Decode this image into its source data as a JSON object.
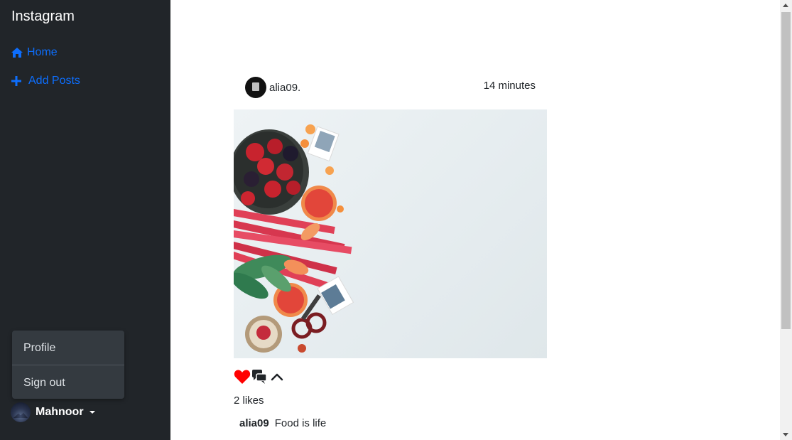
{
  "sidebar": {
    "brand": "Instagram",
    "items": [
      {
        "label": "Home",
        "icon": "home-icon"
      },
      {
        "label": "Add Posts",
        "icon": "plus-icon"
      }
    ],
    "dropdown": {
      "items": [
        {
          "label": "Profile"
        },
        {
          "label": "Sign out"
        }
      ]
    },
    "user": {
      "name": "Mahnoor"
    }
  },
  "post": {
    "username": "alia09.",
    "time": "14 minutes",
    "likes": "2 likes",
    "caption_user": "alia09",
    "caption_text": "Food is life",
    "actions": [
      {
        "icon": "heart-icon",
        "color": "#ff0000"
      },
      {
        "icon": "comments-icon",
        "color": "#212529"
      },
      {
        "icon": "chevron-up-icon",
        "color": "#212529"
      }
    ]
  },
  "colors": {
    "sidebar_bg": "#212529",
    "link": "#0d6efd",
    "dropdown_bg": "#343a40"
  }
}
